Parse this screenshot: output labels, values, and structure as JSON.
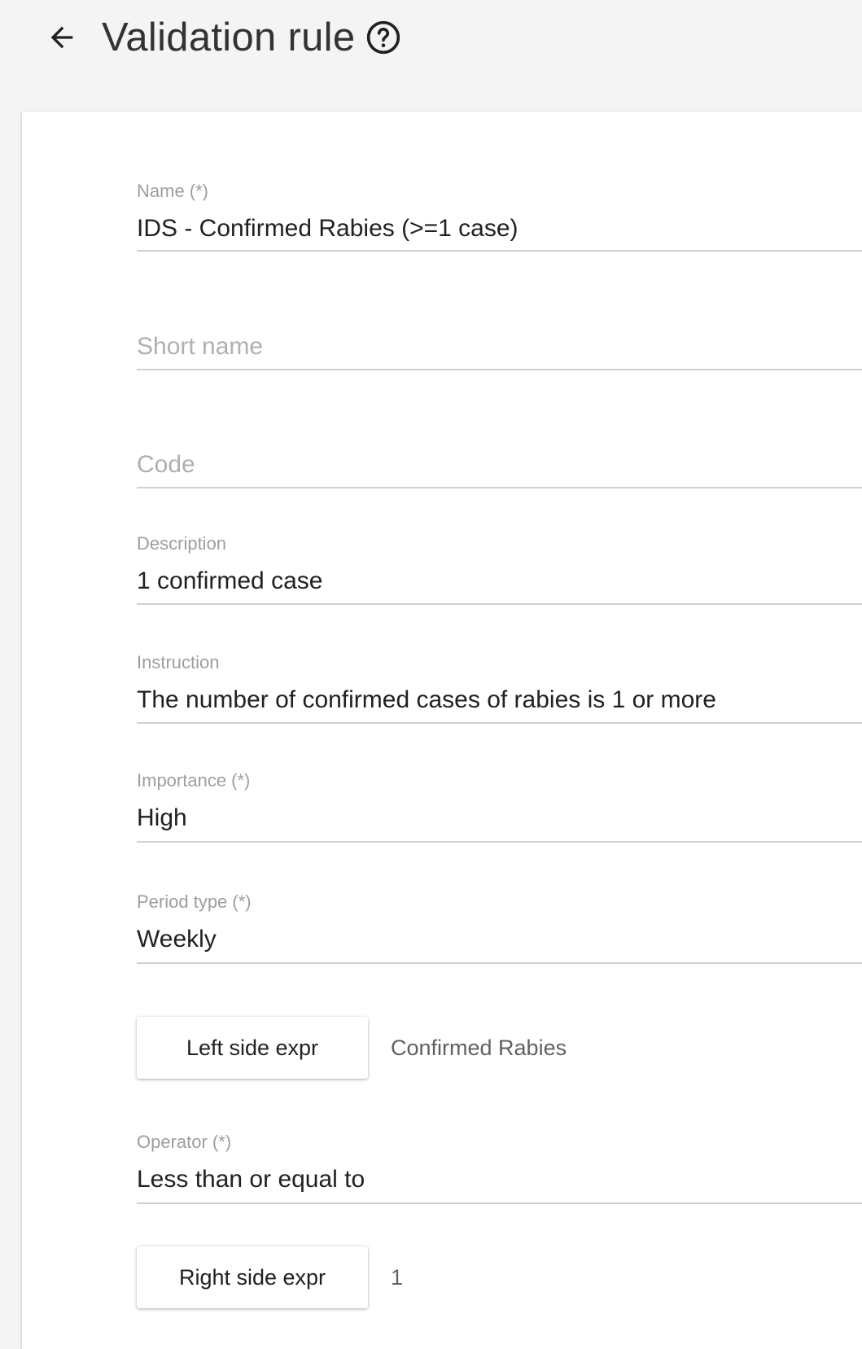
{
  "header": {
    "title": "Validation rule",
    "back_icon": "arrow-left-icon",
    "help_icon": "help-circle-icon"
  },
  "form": {
    "name": {
      "label": "Name (*)",
      "value": "IDS - Confirmed Rabies (>=1 case)"
    },
    "short_name": {
      "placeholder": "Short name"
    },
    "code": {
      "placeholder": "Code"
    },
    "description": {
      "label": "Description",
      "value": "1 confirmed case"
    },
    "instruction": {
      "label": "Instruction",
      "value": "The number of confirmed cases of rabies is 1 or more"
    },
    "importance": {
      "label": "Importance (*)",
      "value": "High"
    },
    "period_type": {
      "label": "Period type (*)",
      "value": "Weekly"
    },
    "left_side": {
      "button_label": "Left side expr",
      "description": "Confirmed Rabies"
    },
    "operator": {
      "label": "Operator (*)",
      "value": "Less than or equal to"
    },
    "right_side": {
      "button_label": "Right side expr",
      "description": "1"
    }
  },
  "colors": {
    "background": "#f4f4f4",
    "card": "#ffffff",
    "label": "#9e9e9e",
    "text": "#212121",
    "underline": "#d0d0d0"
  }
}
